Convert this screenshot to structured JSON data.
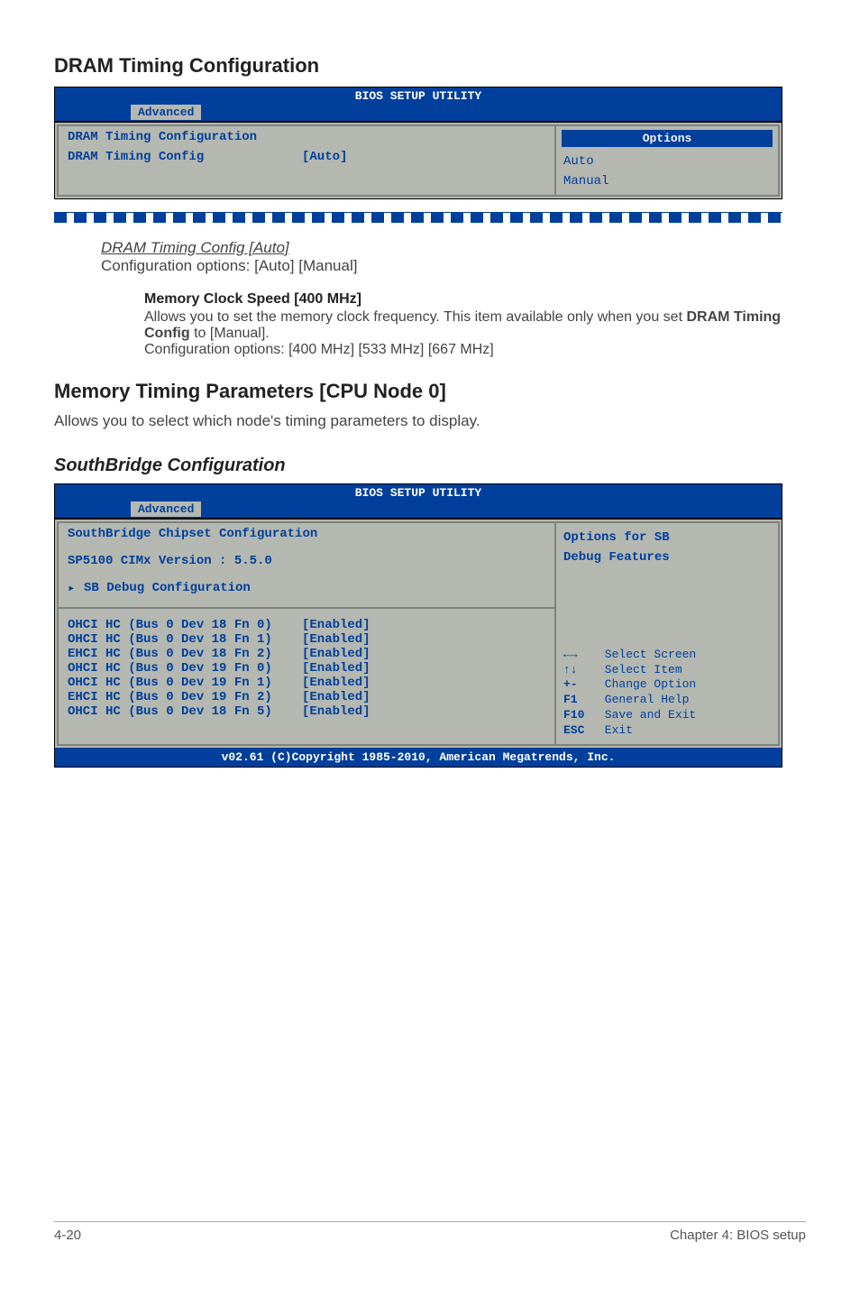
{
  "section1": {
    "title": "DRAM Timing Configuration",
    "bios": {
      "utility_title": "BIOS SETUP UTILITY",
      "tab": "Advanced",
      "panel_title": "DRAM Timing Configuration",
      "row1": {
        "label": "DRAM Timing Config",
        "value": "[Auto]"
      },
      "options_header": "Options",
      "options": [
        "Auto",
        "Manual"
      ]
    },
    "config_item": {
      "title": "DRAM Timing Config [Auto]",
      "desc": "Configuration options: [Auto] [Manual]"
    },
    "memclock": {
      "title": "Memory Clock Speed [400 MHz]",
      "line1": "Allows you to set the memory clock frequency. This item available only when you set ",
      "bold": "DRAM Timing Config",
      "line1b": " to [Manual].",
      "line2": "Configuration options: [400 MHz] [533 MHz] [667 MHz]"
    }
  },
  "section2": {
    "title": "Memory Timing Parameters [CPU Node 0]",
    "desc": "Allows you to select which node's timing parameters to display."
  },
  "section3": {
    "title": "SouthBridge Configuration",
    "bios": {
      "utility_title": "BIOS SETUP UTILITY",
      "tab": "Advanced",
      "panel_title": "SouthBridge Chipset Configuration",
      "version": "SP5100 CIMx Version : 5.5.0",
      "submenu": "SB Debug Configuration",
      "help1": "Options for SB",
      "help2": "Debug Features",
      "hc": [
        {
          "label": "OHCI HC (Bus 0 Dev 18 Fn 0)",
          "value": "[Enabled]"
        },
        {
          "label": "OHCI HC (Bus 0 Dev 18 Fn 1)",
          "value": "[Enabled]"
        },
        {
          "label": "EHCI HC (Bus 0 Dev 18 Fn 2)",
          "value": "[Enabled]"
        },
        {
          "label": "OHCI HC (Bus 0 Dev 19 Fn 0)",
          "value": "[Enabled]"
        },
        {
          "label": "OHCI HC (Bus 0 Dev 19 Fn 1)",
          "value": "[Enabled]"
        },
        {
          "label": "EHCI HC (Bus 0 Dev 19 Fn 2)",
          "value": "[Enabled]"
        },
        {
          "label": "OHCI HC (Bus 0 Dev 18 Fn 5)",
          "value": "[Enabled]"
        }
      ],
      "nav": [
        {
          "key": "←→",
          "label": "Select Screen"
        },
        {
          "key": "↑↓",
          "label": "Select Item"
        },
        {
          "key": "+-",
          "label": "Change Option"
        },
        {
          "key": "F1",
          "label": "General Help"
        },
        {
          "key": "F10",
          "label": "Save and Exit"
        },
        {
          "key": "ESC",
          "label": "Exit"
        }
      ],
      "footer": "v02.61 (C)Copyright 1985-2010, American Megatrends, Inc."
    }
  },
  "footer": {
    "left": "4-20",
    "right": "Chapter 4: BIOS setup"
  }
}
